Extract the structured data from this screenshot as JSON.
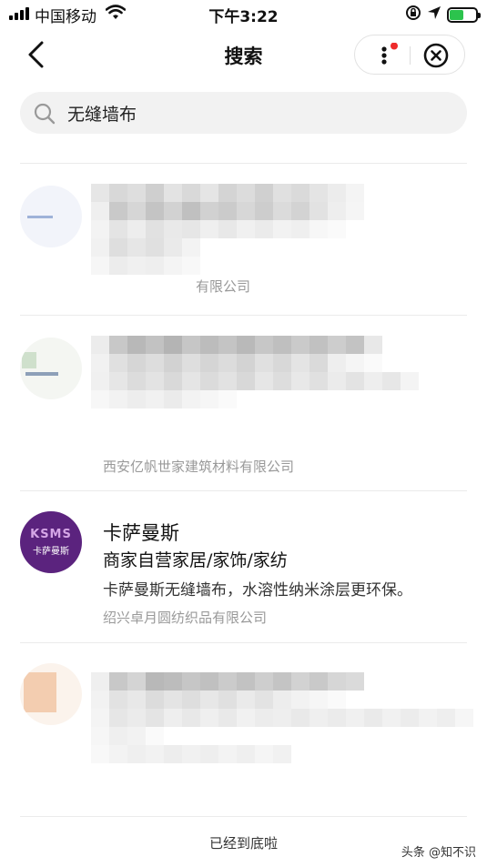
{
  "status_bar": {
    "carrier": "中国移动",
    "time": "下午3:22"
  },
  "nav": {
    "title": "搜索"
  },
  "search": {
    "value": "无缝墙布"
  },
  "results": [
    {
      "company_fragment": "有限公司"
    },
    {
      "company": "西安亿帆世家建筑材料有限公司"
    },
    {
      "logo_text": "KSMS",
      "logo_subtext": "卡萨曼斯",
      "title": "卡萨曼斯",
      "category": "商家自营家居/家饰/家纺",
      "description": "卡萨曼斯无缝墙布，水溶性纳米涂层更环保。",
      "company": "绍兴卓月圆纺织品有限公司"
    },
    {}
  ],
  "footer": {
    "end_text": "已经到底啦"
  },
  "watermark": "头条 @知不识",
  "colors": {
    "brand_purple": "#5b237e",
    "battery_green": "#2cc34d",
    "badge_red": "#ee2b2b"
  }
}
